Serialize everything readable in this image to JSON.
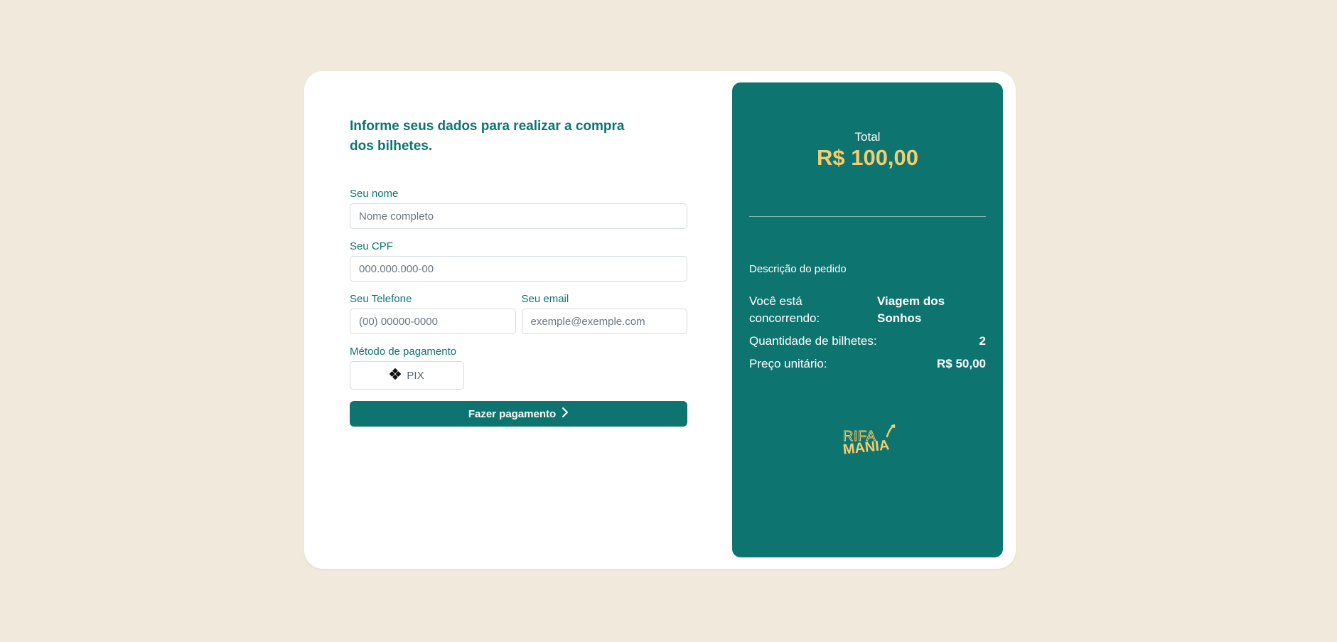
{
  "form": {
    "heading": "Informe seus dados para realizar a compra dos bilhetes.",
    "name": {
      "label": "Seu nome",
      "placeholder": "Nome completo",
      "value": ""
    },
    "cpf": {
      "label": "Seu CPF",
      "placeholder": "000.000.000-00",
      "value": ""
    },
    "phone": {
      "label": "Seu Telefone",
      "placeholder": "(00) 00000-0000",
      "value": ""
    },
    "email": {
      "label": "Seu email",
      "placeholder": "exemple@exemple.com",
      "value": ""
    },
    "payment_method": {
      "label": "Método de pagamento",
      "option_label": "PIX",
      "icon": "pix-icon"
    },
    "submit_label": "Fazer pagamento"
  },
  "summary": {
    "total_label": "Total",
    "total_value": "R$ 100,00",
    "description_title": "Descrição do pedido",
    "rows": [
      {
        "label": "Você está concorrendo:",
        "value": "Viagem dos Sonhos"
      },
      {
        "label": "Quantidade de bilhetes:",
        "value": "2"
      },
      {
        "label": "Preço unitário:",
        "value": "R$ 50,00"
      }
    ],
    "logo": {
      "line1": "RIFA",
      "line2": "MANIA"
    }
  },
  "colors": {
    "background": "#f0e9dc",
    "primary": "#0e7470",
    "accent": "#f6cd6e",
    "card": "#ffffff"
  }
}
